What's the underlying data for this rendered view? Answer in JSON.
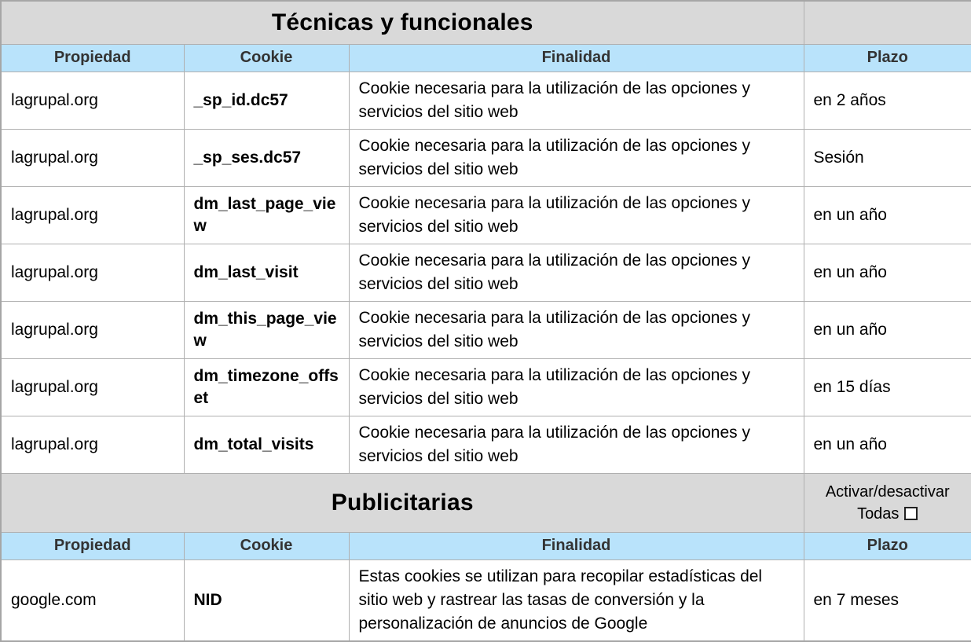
{
  "colors": {
    "header_bg": "#b9e3fb",
    "section_bg": "#d9d9d9",
    "grid_border": "#b0b0b0",
    "outer_border": "#a6a6a6",
    "header_text": "#333333",
    "body_text": "#000000"
  },
  "sections": [
    {
      "title": "Técnicas y funcionales",
      "headers": [
        "Propiedad",
        "Cookie",
        "Finalidad",
        "Plazo"
      ],
      "rows": [
        {
          "propiedad": "lagrupal.org",
          "cookie": "_sp_id.dc57",
          "finalidad": "Cookie necesaria para la utilización de las opciones y servicios del sitio web",
          "plazo": "en 2 años"
        },
        {
          "propiedad": "lagrupal.org",
          "cookie": "_sp_ses.dc57",
          "finalidad": "Cookie necesaria para la utilización de las opciones y servicios del sitio web",
          "plazo": "Sesión"
        },
        {
          "propiedad": "lagrupal.org",
          "cookie": "dm_last_page_view",
          "finalidad": "Cookie necesaria para la utilización de las opciones y servicios del sitio web",
          "plazo": "en un año"
        },
        {
          "propiedad": "lagrupal.org",
          "cookie": "dm_last_visit",
          "finalidad": "Cookie necesaria para la utilización de las opciones y servicios del sitio web",
          "plazo": "en un año"
        },
        {
          "propiedad": "lagrupal.org",
          "cookie": "dm_this_page_view",
          "finalidad": "Cookie necesaria para la utilización de las opciones y servicios del sitio web",
          "plazo": "en un año"
        },
        {
          "propiedad": "lagrupal.org",
          "cookie": "dm_timezone_offset",
          "finalidad": "Cookie necesaria para la utilización de las opciones y servicios del sitio web",
          "plazo": "en 15 días"
        },
        {
          "propiedad": "lagrupal.org",
          "cookie": "dm_total_visits",
          "finalidad": "Cookie necesaria para la utilización de las opciones y servicios del sitio web",
          "plazo": "en un año"
        }
      ]
    },
    {
      "title": "Publicitarias",
      "toggle": {
        "line1": "Activar/desactivar",
        "line2": "Todas",
        "checked": false
      },
      "headers": [
        "Propiedad",
        "Cookie",
        "Finalidad",
        "Plazo"
      ],
      "rows": [
        {
          "propiedad": "google.com",
          "cookie": "NID",
          "finalidad": "Estas cookies se utilizan para recopilar estadísticas del sitio web y rastrear las tasas de conversión y la personalización de anuncios de Google",
          "plazo": "en 7 meses"
        }
      ]
    }
  ]
}
